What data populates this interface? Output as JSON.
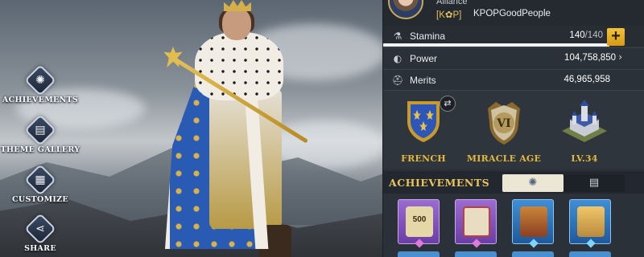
{
  "menu": {
    "items": [
      {
        "label": "ACHIEVEMENTS",
        "icon": "achievement-icon"
      },
      {
        "label": "THEME GALLERY",
        "icon": "gallery-icon"
      },
      {
        "label": "CUSTOMIZE",
        "icon": "customize-icon"
      },
      {
        "label": "SHARE",
        "icon": "share-icon"
      }
    ]
  },
  "profile": {
    "alliance_label": "Alliance",
    "alliance_tag": "[K✿P]",
    "alliance_name": "KPOPGoodPeople"
  },
  "stats": {
    "stamina": {
      "label": "Stamina",
      "current": "140",
      "max": "/140",
      "fill_fraction": 1.0,
      "icon": "potion-icon"
    },
    "power": {
      "label": "Power",
      "value": "104,758,850",
      "icon": "power-icon"
    },
    "merits": {
      "label": "Merits",
      "value": "46,965,958",
      "icon": "helmet-icon"
    }
  },
  "emblems": [
    {
      "label": "FRENCH",
      "icon": "fleur-de-lis-shield-icon"
    },
    {
      "label": "MIRACLE AGE",
      "icon": "age-vi-emblem-icon",
      "numeral": "VI"
    },
    {
      "label": "LV.34",
      "icon": "castle-icon"
    }
  ],
  "achievements": {
    "title": "ACHIEVEMENTS",
    "badges": [
      {
        "number": "500",
        "tier": "purple"
      },
      {
        "number": "",
        "tier": "purple"
      },
      {
        "number": "",
        "tier": "blue"
      },
      {
        "number": "",
        "tier": "blue"
      }
    ]
  },
  "colors": {
    "accent_gold": "#e4b73d",
    "panel_bg": "#2b3138",
    "plus_button": "#f2c33b"
  }
}
